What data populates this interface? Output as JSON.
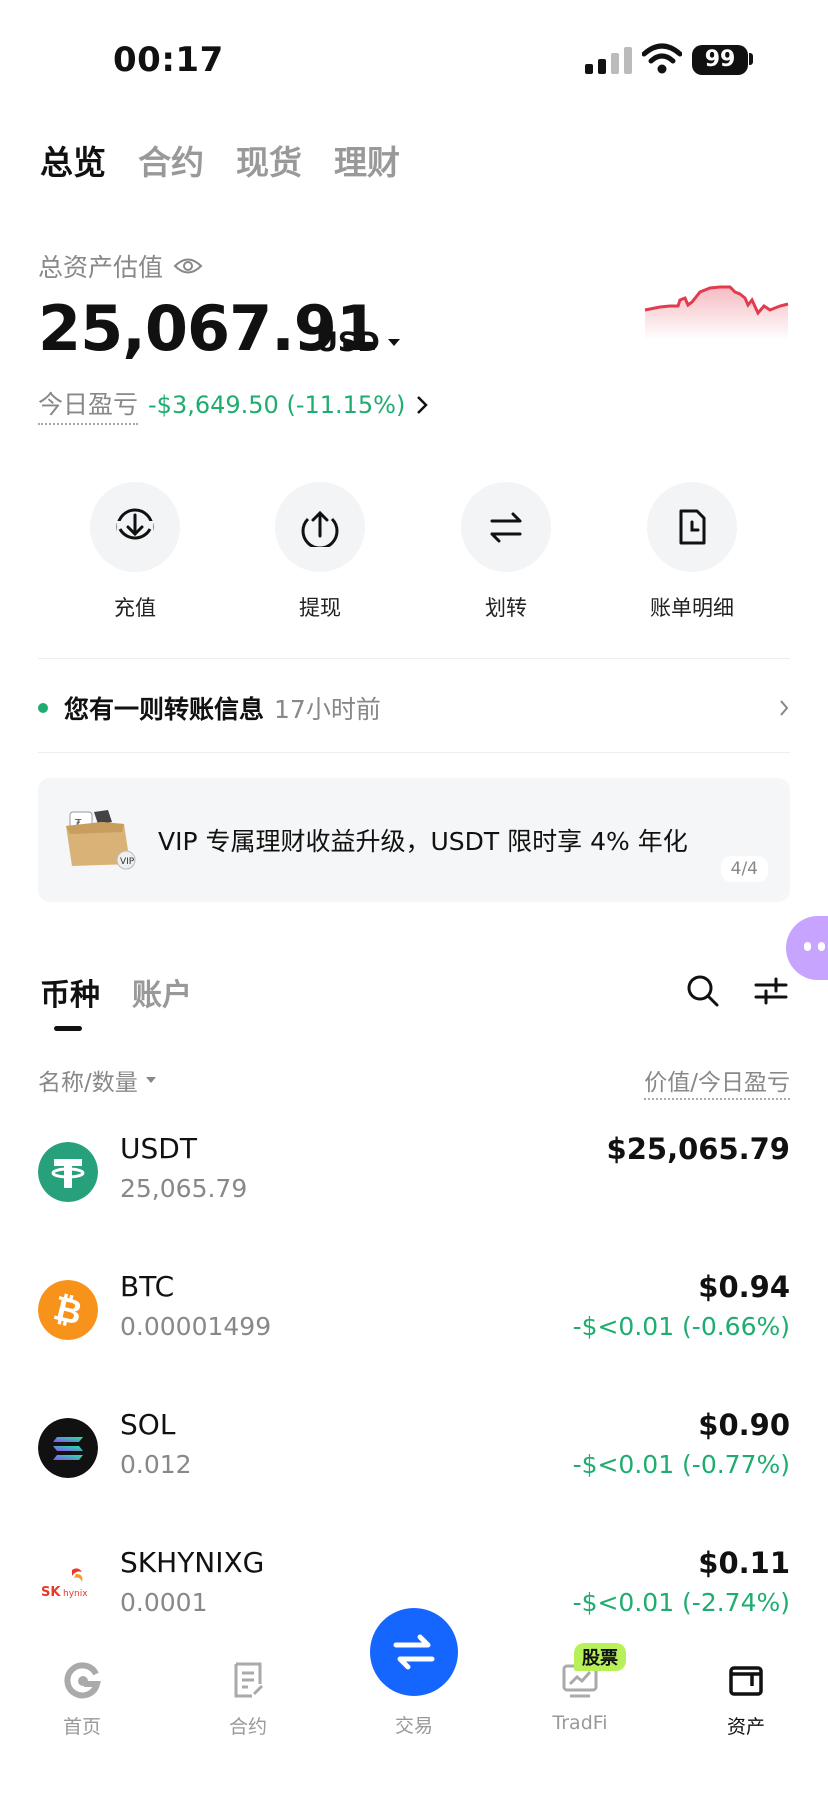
{
  "status_bar": {
    "time": "00:17",
    "battery": "99"
  },
  "top_tabs": [
    {
      "label": "总览",
      "active": true
    },
    {
      "label": "合约",
      "active": false
    },
    {
      "label": "现货",
      "active": false
    },
    {
      "label": "理财",
      "active": false
    }
  ],
  "overview": {
    "label": "总资产估值",
    "total_value": "25,067.91",
    "currency": "USD",
    "pnl_label": "今日盈亏",
    "pnl_value": "-$3,649.50 (-11.15%)"
  },
  "actions": [
    {
      "label": "充值",
      "icon": "deposit-icon"
    },
    {
      "label": "提现",
      "icon": "withdraw-icon"
    },
    {
      "label": "划转",
      "icon": "transfer-icon"
    },
    {
      "label": "账单明细",
      "icon": "bill-icon"
    }
  ],
  "notice": {
    "text": "您有一则转账信息",
    "time": "17小时前"
  },
  "banner": {
    "text": "VIP 专属理财收益升级，USDT 限时享 4% 年化",
    "page": "4/4"
  },
  "list_tabs": [
    {
      "label": "币种",
      "active": true
    },
    {
      "label": "账户",
      "active": false
    }
  ],
  "columns": {
    "left": "名称/数量",
    "right": "价值/今日盈亏"
  },
  "coins": [
    {
      "name": "USDT",
      "amount": "25,065.79",
      "value": "$25,065.79",
      "pnl": "",
      "color": "#26a17b"
    },
    {
      "name": "BTC",
      "amount": "0.00001499",
      "value": "$0.94",
      "pnl": "-$<0.01 (-0.66%)",
      "color": "#f7931a"
    },
    {
      "name": "SOL",
      "amount": "0.012",
      "value": "$0.90",
      "pnl": "-$<0.01 (-0.77%)",
      "color": "#111111"
    },
    {
      "name": "SKHYNIXG",
      "amount": "0.0001",
      "value": "$0.11",
      "pnl": "-$<0.01 (-2.74%)",
      "color": "#ffffff"
    }
  ],
  "bottom_nav": [
    {
      "label": "首页",
      "icon": "home-icon"
    },
    {
      "label": "合约",
      "icon": "contract-icon"
    },
    {
      "label": "交易",
      "icon": "trade-icon"
    },
    {
      "label": "TradFi",
      "icon": "tradfi-icon",
      "badge": "股票"
    },
    {
      "label": "资产",
      "icon": "assets-icon",
      "active": true
    }
  ],
  "colors": {
    "green": "#1fad6f",
    "accent_blue": "#1565ff",
    "sparkline_red": "#e23b4e"
  }
}
